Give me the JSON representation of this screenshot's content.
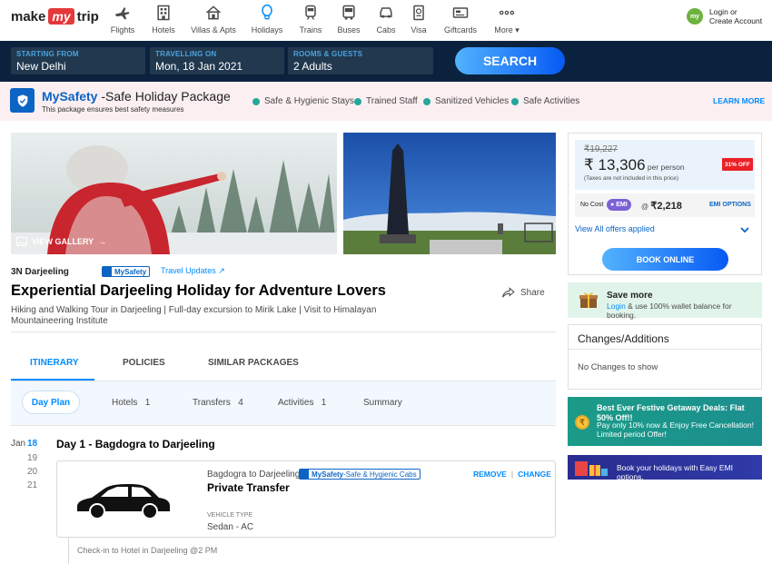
{
  "brand": {
    "make": "make",
    "my": "my",
    "trip": "trip"
  },
  "nav": {
    "items": [
      {
        "label": "Flights",
        "icon": "plane-icon"
      },
      {
        "label": "Hotels",
        "icon": "building-icon"
      },
      {
        "label": "Villas & Apts",
        "icon": "house-icon"
      },
      {
        "label": "Holidays",
        "icon": "balloon-icon"
      },
      {
        "label": "Trains",
        "icon": "train-icon"
      },
      {
        "label": "Buses",
        "icon": "bus-icon"
      },
      {
        "label": "Cabs",
        "icon": "car-icon"
      },
      {
        "label": "Visa",
        "icon": "passport-icon"
      },
      {
        "label": "Giftcards",
        "icon": "giftcard-icon"
      },
      {
        "label": "More",
        "icon": "dots-icon"
      }
    ],
    "login": {
      "avatar_text": "my",
      "line1": "Login or",
      "line2": "Create Account"
    }
  },
  "search": {
    "from_label": "STARTING FROM",
    "from_value": "New Delhi",
    "date_label": "TRAVELLING ON",
    "date_value": "Mon, 18 Jan 2021",
    "rooms_label": "ROOMS & GUESTS",
    "rooms_value": "2 Adults",
    "button": "SEARCH"
  },
  "safety": {
    "brand": "MySafety",
    "title_rest": " -Safe Holiday Package",
    "subtitle": "This package ensures best safety measures",
    "points": [
      "Safe & Hygienic Stays",
      "Trained Staff",
      "Sanitized Vehicles",
      "Safe Activities"
    ],
    "learn_more": "LEARN MORE"
  },
  "gallery": {
    "label": "VIEW GALLERY"
  },
  "package": {
    "nights": "3N Darjeeling",
    "badge": "MySafety",
    "travel_updates": "Travel Updates",
    "title": "Experiential Darjeeling Holiday for Adventure Lovers",
    "share": "Share",
    "description": "Hiking and Walking Tour in Darjeeling | Full-day excursion to Mirik Lake | Visit to Himalayan Mountaineering Institute"
  },
  "tabs": [
    "ITINERARY",
    "POLICIES",
    "SIMILAR PACKAGES"
  ],
  "subtabs": {
    "day_plan": "Day Plan",
    "hotels_label": "Hotels",
    "hotels_count": "1",
    "transfers_label": "Transfers",
    "transfers_count": "4",
    "activities_label": "Activities",
    "activities_count": "1",
    "summary": "Summary"
  },
  "days": {
    "month": "Jan",
    "list": [
      "18",
      "19",
      "20",
      "21"
    ]
  },
  "day1": {
    "prefix": "Day 1 - ",
    "title": "Bagdogra to Darjeeling"
  },
  "transfer": {
    "route": "Bagdogra to Darjeeling",
    "badge_brand": "MySafety",
    "badge_rest": " -Safe & Hygienic Cabs",
    "title": "Private Transfer",
    "remove": "REMOVE",
    "change": "CHANGE",
    "vehicle_label": "VEHICLE TYPE",
    "vehicle_value": "Sedan - AC"
  },
  "checkin": "Check-in to Hotel in Darjeeling @2 PM",
  "price": {
    "original": "₹19,227",
    "current": "₹ 13,306",
    "per": " per person",
    "taxes": "(Taxes are not included in this price)",
    "off": "31% OFF",
    "no_cost": "No Cost",
    "emi": "EMI",
    "emi_at": "@ ",
    "emi_amount": "₹2,218",
    "emi_options": "EMI OPTIONS",
    "offers": "View All offers applied",
    "book": "BOOK ONLINE"
  },
  "save_more": {
    "title": "Save more",
    "login": "Login",
    "desc": " & use 100% wallet balance for booking."
  },
  "changes": {
    "title": "Changes/Additions",
    "desc": "No Changes to show"
  },
  "festive": {
    "title": "Best Ever Festive Getaway Deals: Flat 50% Off!!",
    "desc": "Pay only 10% now & Enjoy Free Cancellation! Limited period Offer!"
  },
  "emi_banner": {
    "text": "Book your holidays with Easy EMI options."
  },
  "colors": {
    "accent": "#008cff",
    "navy": "#0a223d",
    "brand_red": "#e5383b",
    "safety_blue": "#0c64c4"
  }
}
